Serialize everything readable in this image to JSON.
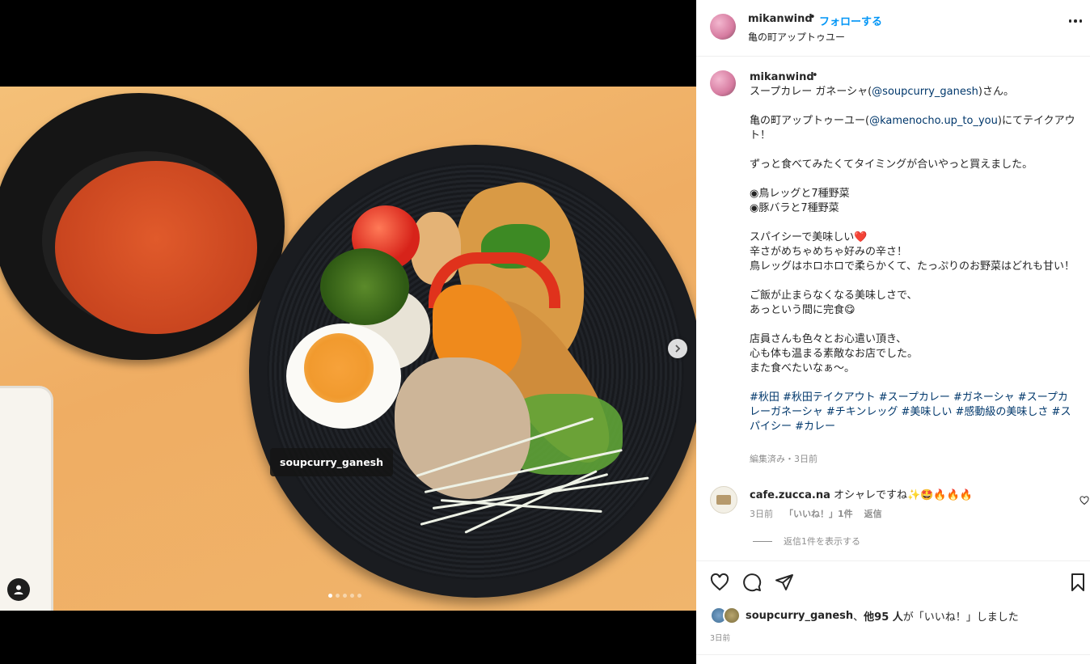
{
  "media": {
    "photo_tag": "soupcurry_ganesh",
    "carousel": {
      "count": 5,
      "active": 1
    }
  },
  "header": {
    "username": "mikanwind",
    "separator": "•",
    "follow_label": "フォローする",
    "location": "亀の町アップトゥユー"
  },
  "caption": {
    "username": "mikanwind",
    "separator": "•",
    "intro_before": "スープカレー ガネーシャ(",
    "mention1": "@soupcurry_ganesh",
    "intro_after": ")さん。",
    "loc_before": "亀の町アップトゥーユー(",
    "mention2": "@kamenocho.up_to_you",
    "loc_after": ")にてテイクアウト！",
    "line_wait": "ずっと食べてみたくてタイミングが合いやっと買えました。",
    "menu1": "◉鳥レッグと7種野菜",
    "menu2": "◉豚バラと7種野菜",
    "line_spicy": "スパイシーで美味しい",
    "heart_emoji": "❤️",
    "line_hot": "辛さがめちゃめちゃ好みの辛さ！",
    "line_leg": "鳥レッグはホロホロで柔らかくて、たっぷりのお野菜はどれも甘い！",
    "line_rice": "ご飯が止まらなくなる美味しさで、",
    "line_done": "あっという間に完食",
    "yum_emoji": "😋",
    "line_staff": "店員さんも色々とお心遣い頂き、",
    "line_warm": "心も体も温まる素敵なお店でした。",
    "line_again": "また食べたいなぁ〜。",
    "hashtags": "#秋田 #秋田テイクアウト #スープカレー #ガネーシャ #スープカレーガネーシャ #チキンレッグ #美味しい #感動級の美味しさ #スパイシー #カレー",
    "meta": "編集済み・3日前"
  },
  "comment": {
    "username": "cafe.zucca.na",
    "text": "オシャレですね✨🤩🔥🔥🔥",
    "time": "3日前",
    "likes": "「いいね！」1件",
    "reply": "返信",
    "view_replies": "返信1件を表示する"
  },
  "likes": {
    "user": "soupcurry_ganesh",
    "sep": "、",
    "others": "他95 人",
    "suffix": "が「いいね！」しました"
  },
  "posted": "3日前",
  "colors": {
    "link": "#00376b",
    "follow": "#0095f6",
    "muted": "#8e8e8e",
    "text": "#262626"
  }
}
